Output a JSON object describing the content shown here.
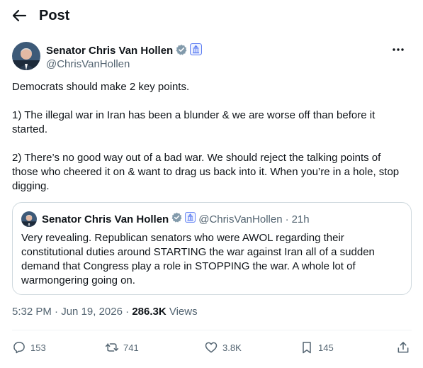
{
  "header": {
    "title": "Post"
  },
  "author": {
    "name": "Senator Chris Van Hollen",
    "handle": "@ChrisVanHollen"
  },
  "post": {
    "paragraphs": [
      "Democrats should make 2 key points.",
      "1) The illegal war in Iran has been a blunder & we are worse off than before it started.",
      "2) There’s no good way out of a bad war. We should reject the talking points of those who cheered it on & want to drag us back into it. When you’re in a hole, stop digging."
    ]
  },
  "quote": {
    "name": "Senator Chris Van Hollen",
    "handle": "@ChrisVanHollen",
    "separator": "·",
    "age": "21h",
    "text": "Very revealing. Republican senators who were AWOL regarding their constitutional duties around STARTING the war against Iran all of a sudden demand that Congress play a role in STOPPING the war. A whole lot of warmongering going on."
  },
  "meta": {
    "time": "5:32 PM",
    "separator": "·",
    "date": "Jun 19, 2026",
    "views_count": "286.3K",
    "views_label": "Views"
  },
  "actions": {
    "replies": "153",
    "reposts": "741",
    "likes": "3.8K",
    "bookmarks": "145"
  },
  "colors": {
    "text": "#0f1419",
    "secondary": "#536471",
    "border": "#cfd9de",
    "verified_badge": "#829aab",
    "affiliate_badge": "#5b7cf2"
  }
}
